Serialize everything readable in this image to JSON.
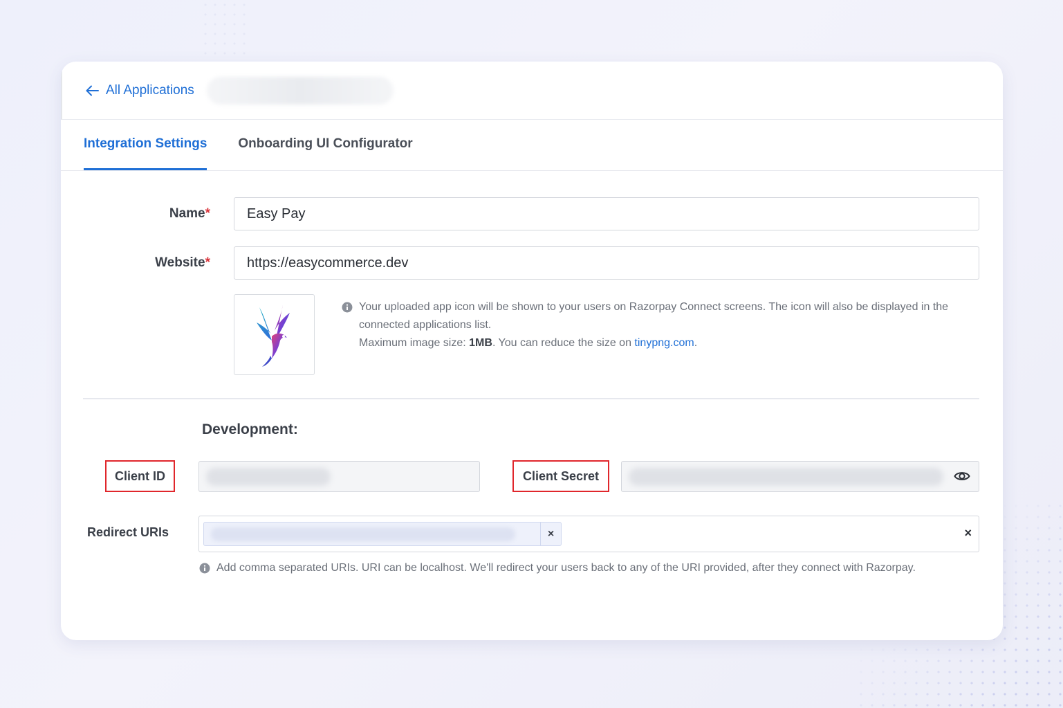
{
  "header": {
    "back_label": "All Applications"
  },
  "tabs": [
    {
      "label": "Integration Settings",
      "active": true
    },
    {
      "label": "Onboarding UI Configurator",
      "active": false
    }
  ],
  "form": {
    "name_label": "Name",
    "name_value": "Easy Pay",
    "website_label": "Website",
    "website_value": "https://easycommerce.dev",
    "required_mark": "*"
  },
  "icon_help": {
    "line1": "Your uploaded app icon will be shown to your users on Razorpay Connect screens. The icon will also be displayed in the connected applications list.",
    "line2_prefix": "Maximum image size: ",
    "line2_size": "1MB",
    "line2_middle": ". You can reduce the size on ",
    "line2_link": "tinypng.com",
    "line2_suffix": "."
  },
  "development": {
    "title": "Development:",
    "client_id_label": "Client ID",
    "client_secret_label": "Client Secret",
    "redirect_label": "Redirect URIs",
    "redirect_help": "Add comma separated URIs. URI can be localhost. We'll redirect your users back to any of the URI provided, after they connect with Razorpay.",
    "chip_remove": "×",
    "clear_all": "×"
  },
  "colors": {
    "accent": "#1f6fd6",
    "required": "#d9343b",
    "highlight_box": "#e0262b"
  }
}
